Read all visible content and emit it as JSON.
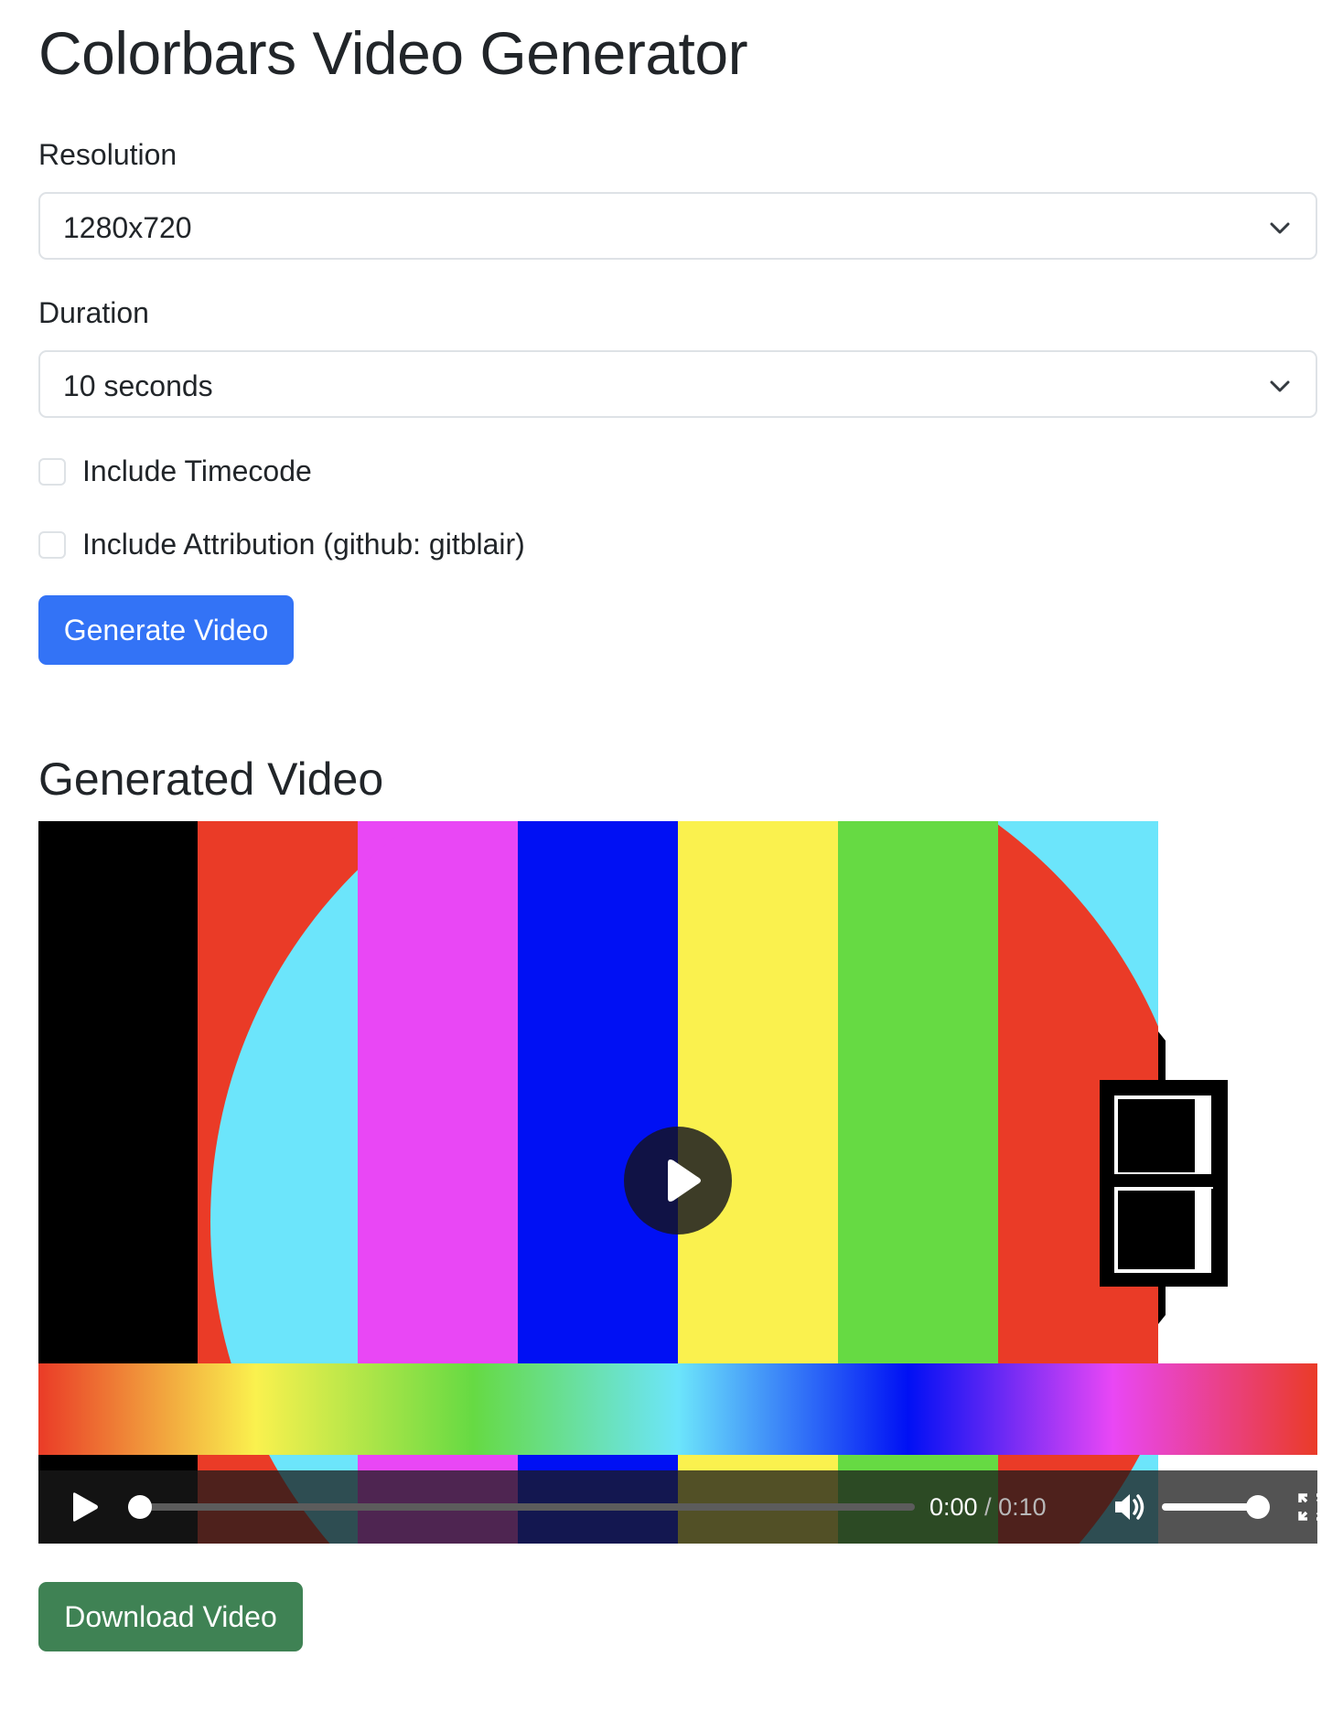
{
  "page": {
    "title": "Colorbars Video Generator"
  },
  "form": {
    "resolution_label": "Resolution",
    "resolution_value": "1280x720",
    "duration_label": "Duration",
    "duration_value": "10 seconds",
    "timecode_label": "Include Timecode",
    "timecode_checked": false,
    "attribution_label": "Include Attribution (github: gitblair)",
    "attribution_checked": false,
    "generate_label": "Generate Video"
  },
  "result": {
    "heading": "Generated Video",
    "player": {
      "current_time": "0:00",
      "separator": "/",
      "duration": "0:10",
      "progress": 0.0,
      "volume": 1.0
    },
    "download_label": "Download Video"
  },
  "colors": {
    "primary": "#3373f6",
    "success": "#3f8254",
    "bars": [
      "#000000",
      "#ea3b27",
      "#6ce5fb",
      "#e947f5",
      "#0010f4",
      "#faf14e",
      "#66da43",
      "#ea3b27",
      "#6ce5fb"
    ]
  },
  "icons": {
    "select_chevron": "chevron-down-icon",
    "big_play": "play-icon",
    "play": "play-icon",
    "volume": "volume-icon",
    "fullscreen": "fullscreen-icon"
  }
}
